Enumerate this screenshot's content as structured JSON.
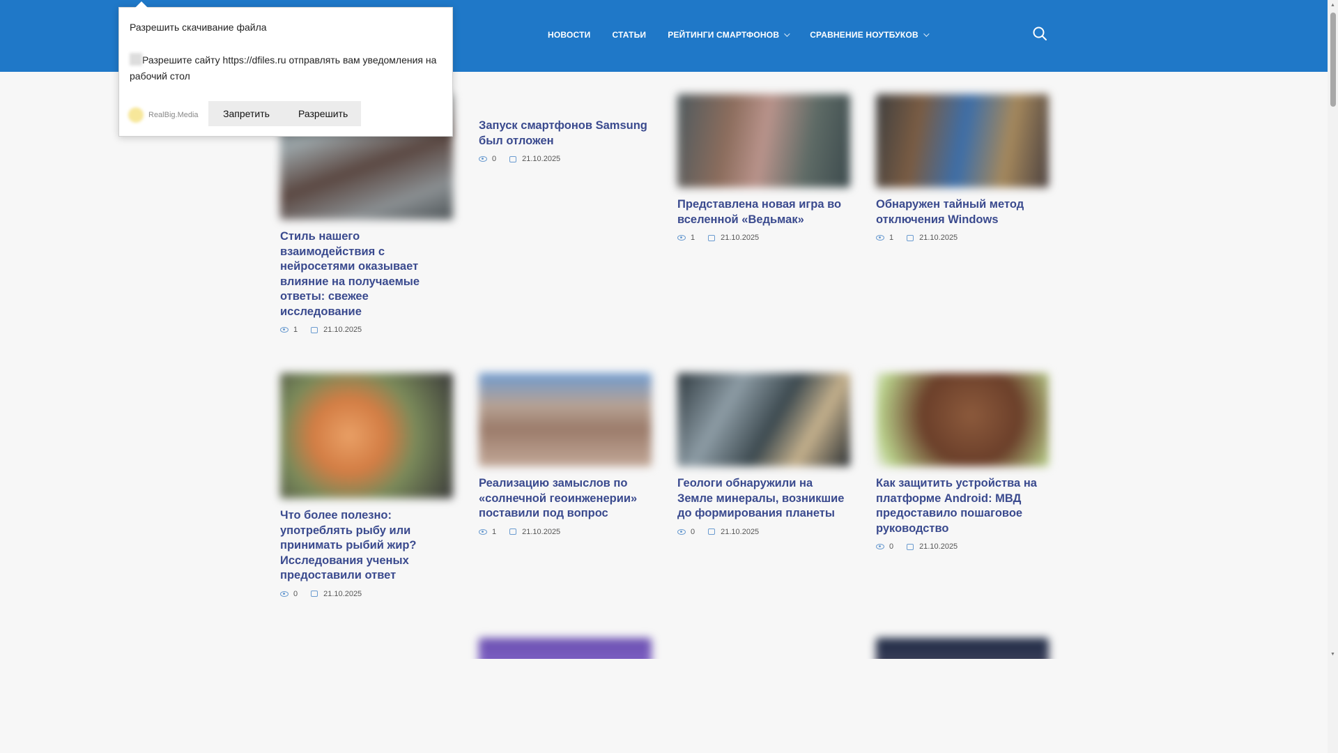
{
  "nav": {
    "items": [
      {
        "label": "НОВОСТИ",
        "dropdown": false
      },
      {
        "label": "СТАТЬИ",
        "dropdown": false
      },
      {
        "label": "РЕЙТИНГИ СМАРТФОНОВ",
        "dropdown": true
      },
      {
        "label": "СРАВНЕНИЕ НОУТБУКОВ",
        "dropdown": true
      }
    ],
    "search_icon": "search-icon"
  },
  "popup": {
    "title": "Разрешить скачивание файла",
    "message": "Разрешите сайту https://dfiles.ru отправлять вам уведомления на рабочий стол",
    "brand": "RealBig.Media",
    "deny_label": "Запретить",
    "allow_label": "Разрешить"
  },
  "cards": [
    {
      "title": "Стиль нашего взаимодействия с нейросетями оказывает влияние на получаемые ответы: свежее исследование",
      "views": "1",
      "date": "21.10.2025"
    },
    {
      "title": "Запуск смартфонов Samsung был отложен",
      "views": "0",
      "date": "21.10.2025"
    },
    {
      "title": "Представлена новая игра во вселенной «Ведьмак»",
      "views": "1",
      "date": "21.10.2025"
    },
    {
      "title": "Обнаружен тайный метод отключения Windows",
      "views": "1",
      "date": "21.10.2025"
    },
    {
      "title": "Что более полезно: употреблять рыбу или принимать рыбий жир? Исследования ученых предоставили ответ",
      "views": "0",
      "date": "21.10.2025"
    },
    {
      "title": "Реализацию замыслов по «солнечной геоинженерии» поставили под вопрос",
      "views": "1",
      "date": "21.10.2025"
    },
    {
      "title": "Геологи обнаружили на Земле минералы, возникшие до формирования планеты",
      "views": "0",
      "date": "21.10.2025"
    },
    {
      "title": "Как защитить устройства на платформе Android: МВД предоставило пошаговое руководство",
      "views": "0",
      "date": "21.10.2025"
    }
  ]
}
